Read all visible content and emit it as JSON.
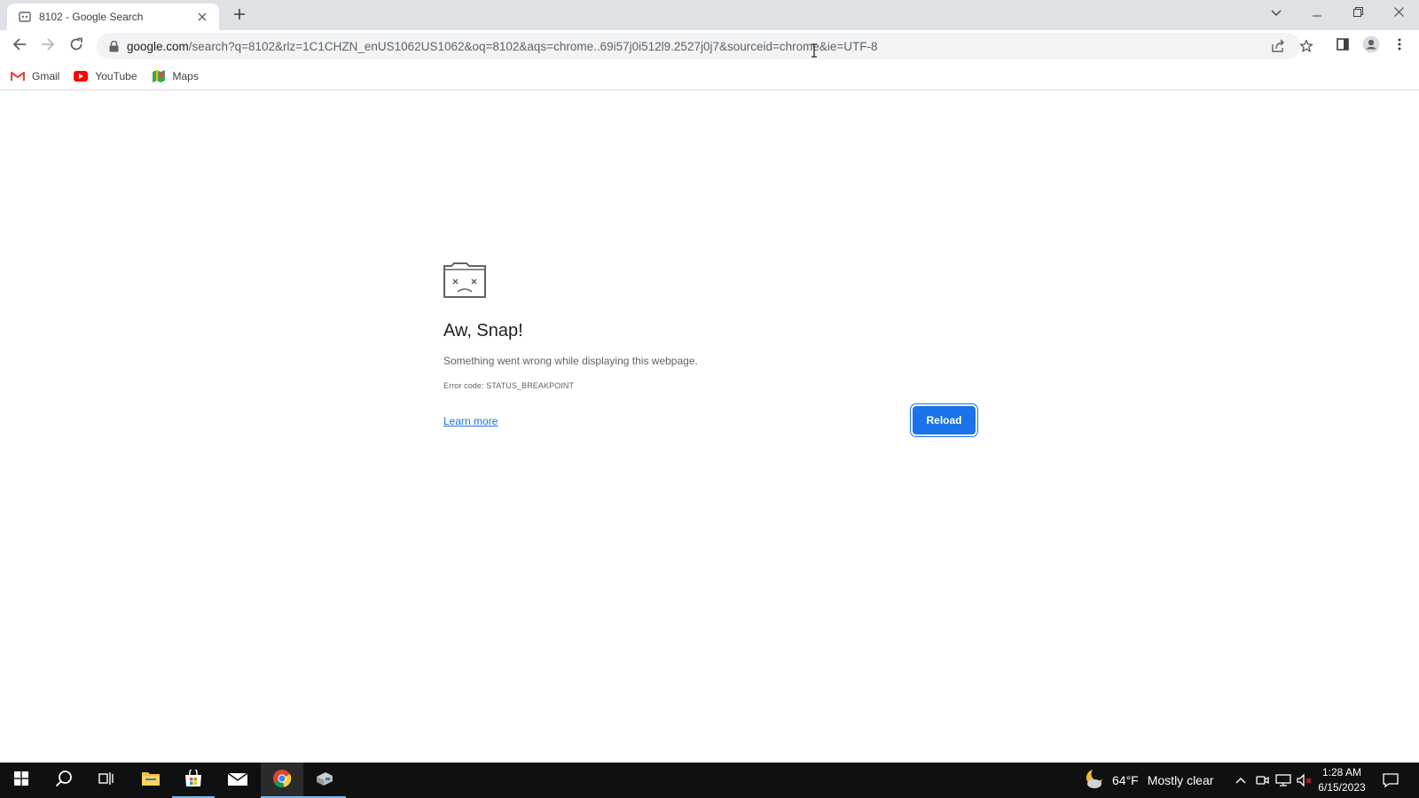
{
  "browser": {
    "tab": {
      "title": "8102 - Google Search",
      "favicon": "google-search-favicon",
      "close_icon": "close-icon"
    },
    "new_tab_icon": "plus-icon",
    "window_controls": [
      "tab-search-chevron-icon",
      "minimize-icon",
      "restore-icon",
      "close-icon"
    ],
    "toolbar": {
      "back_icon": "back-arrow-icon",
      "forward_icon": "forward-arrow-icon",
      "reload_icon": "reload-icon",
      "url_host": "google.com",
      "url_path": "/search?q=8102&rlz=1C1CHZN_enUS1062US1062&oq=8102&aqs=chrome..69i57j0i512l9.2527j0j7&sourceid=chrome&ie=UTF-8",
      "lock_icon": "lock-icon",
      "share_icon": "share-icon",
      "bookmark_icon": "star-icon",
      "sidepanel_icon": "side-panel-icon",
      "profile_icon": "profile-icon",
      "menu_icon": "kebab-menu-icon"
    },
    "bookmarks": [
      {
        "label": "Gmail",
        "icon": "gmail-icon"
      },
      {
        "label": "YouTube",
        "icon": "youtube-icon"
      },
      {
        "label": "Maps",
        "icon": "maps-icon"
      }
    ]
  },
  "error_page": {
    "icon": "sad-tab-icon",
    "title": "Aw, Snap!",
    "message": "Something went wrong while displaying this webpage.",
    "error_code": "Error code: STATUS_BREAKPOINT",
    "learn_more": "Learn more",
    "reload_label": "Reload"
  },
  "taskbar": {
    "apps": [
      "start-icon",
      "search-icon",
      "task-view-icon",
      "file-explorer-icon",
      "store-icon",
      "mail-icon",
      "chrome-icon",
      "app-icon"
    ],
    "active_app": "chrome-icon",
    "weather": {
      "temp": "64°F",
      "condition": "Mostly clear",
      "icon": "moon-cloud-icon"
    },
    "tray": [
      "chevron-up-icon",
      "meet-icon",
      "network-icon",
      "volume-muted-icon"
    ],
    "time": "1:28 AM",
    "date": "6/15/2023",
    "notification_icon": "notification-icon"
  },
  "colors": {
    "accent": "#1a73e8",
    "tabstrip": "#dee1e6",
    "taskbar": "#101010"
  }
}
